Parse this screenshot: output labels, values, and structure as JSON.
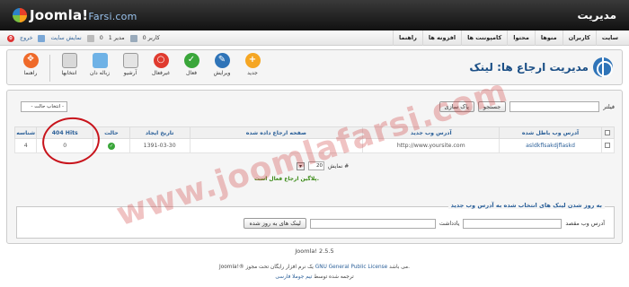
{
  "header": {
    "logo_text": "Joomla!",
    "logo_suffix": "Farsi.com",
    "site_title": "مدیریت"
  },
  "menu": [
    "سایت",
    "کاربران",
    "منوها",
    "محتوا",
    "کامپوننت ها",
    "افزونه ها",
    "راهنما"
  ],
  "status": {
    "logout": "خروج",
    "view_site": "نمایش سایت",
    "view_site_count": "0",
    "admins": "1 مدیر",
    "users": "0 کاربر"
  },
  "toolbar": {
    "title": "مدیریت ارجاع ها: لینک",
    "tools": [
      "جدید",
      "ویرایش",
      "فعال",
      "غیرفعال",
      "آرشیو",
      "زباله دان",
      "انتخابها",
      "راهنما"
    ]
  },
  "filter": {
    "label": "فیلتر",
    "search_button": "جستجو",
    "clear_button": "پاک سازی",
    "state_select": "- انتخاب حالت -"
  },
  "table": {
    "headers": [
      "آدرس وب باطل شده",
      "آدرس وب جدید",
      "صفحه ارجاع داده شده",
      "تاریخ ایجاد",
      "حالت",
      "404 Hits",
      "شناسه"
    ],
    "rows": [
      {
        "old_url": "asldkflsakdjflaskd",
        "new_url": "http://www.yoursite.com",
        "referer": "",
        "created": "1391-03-30",
        "state": "published",
        "hits": "0",
        "id": "4"
      }
    ]
  },
  "pager": {
    "label": "نمایش #",
    "value": "20"
  },
  "plugin_message": "پلاگین ارجاع فعال است.",
  "update": {
    "legend": "به روز شدن لینک های انتخاب شده به آدرس وب جدید",
    "target_label": "آدرس وب مقصد",
    "note_label": "یادداشت",
    "button": "لینک های به روز شده"
  },
  "watermark": "www.joomlafarsi.com",
  "footer": {
    "version": "Joomla! 2.5.5",
    "line1_prefix": "Joomla!® یک نرم افزار رایگان تحت مجوز",
    "line1_link": "GNU General Public License",
    "line1_suffix": "می باشد.",
    "line2_prefix": "ترجمه شده توسط",
    "line2_link": "تیم جوملا فارسی"
  },
  "colors": {
    "header_bg": "#1c1c1c",
    "link": "#2a5f98",
    "success": "#3aa63a",
    "annotation": "#c8141c"
  }
}
